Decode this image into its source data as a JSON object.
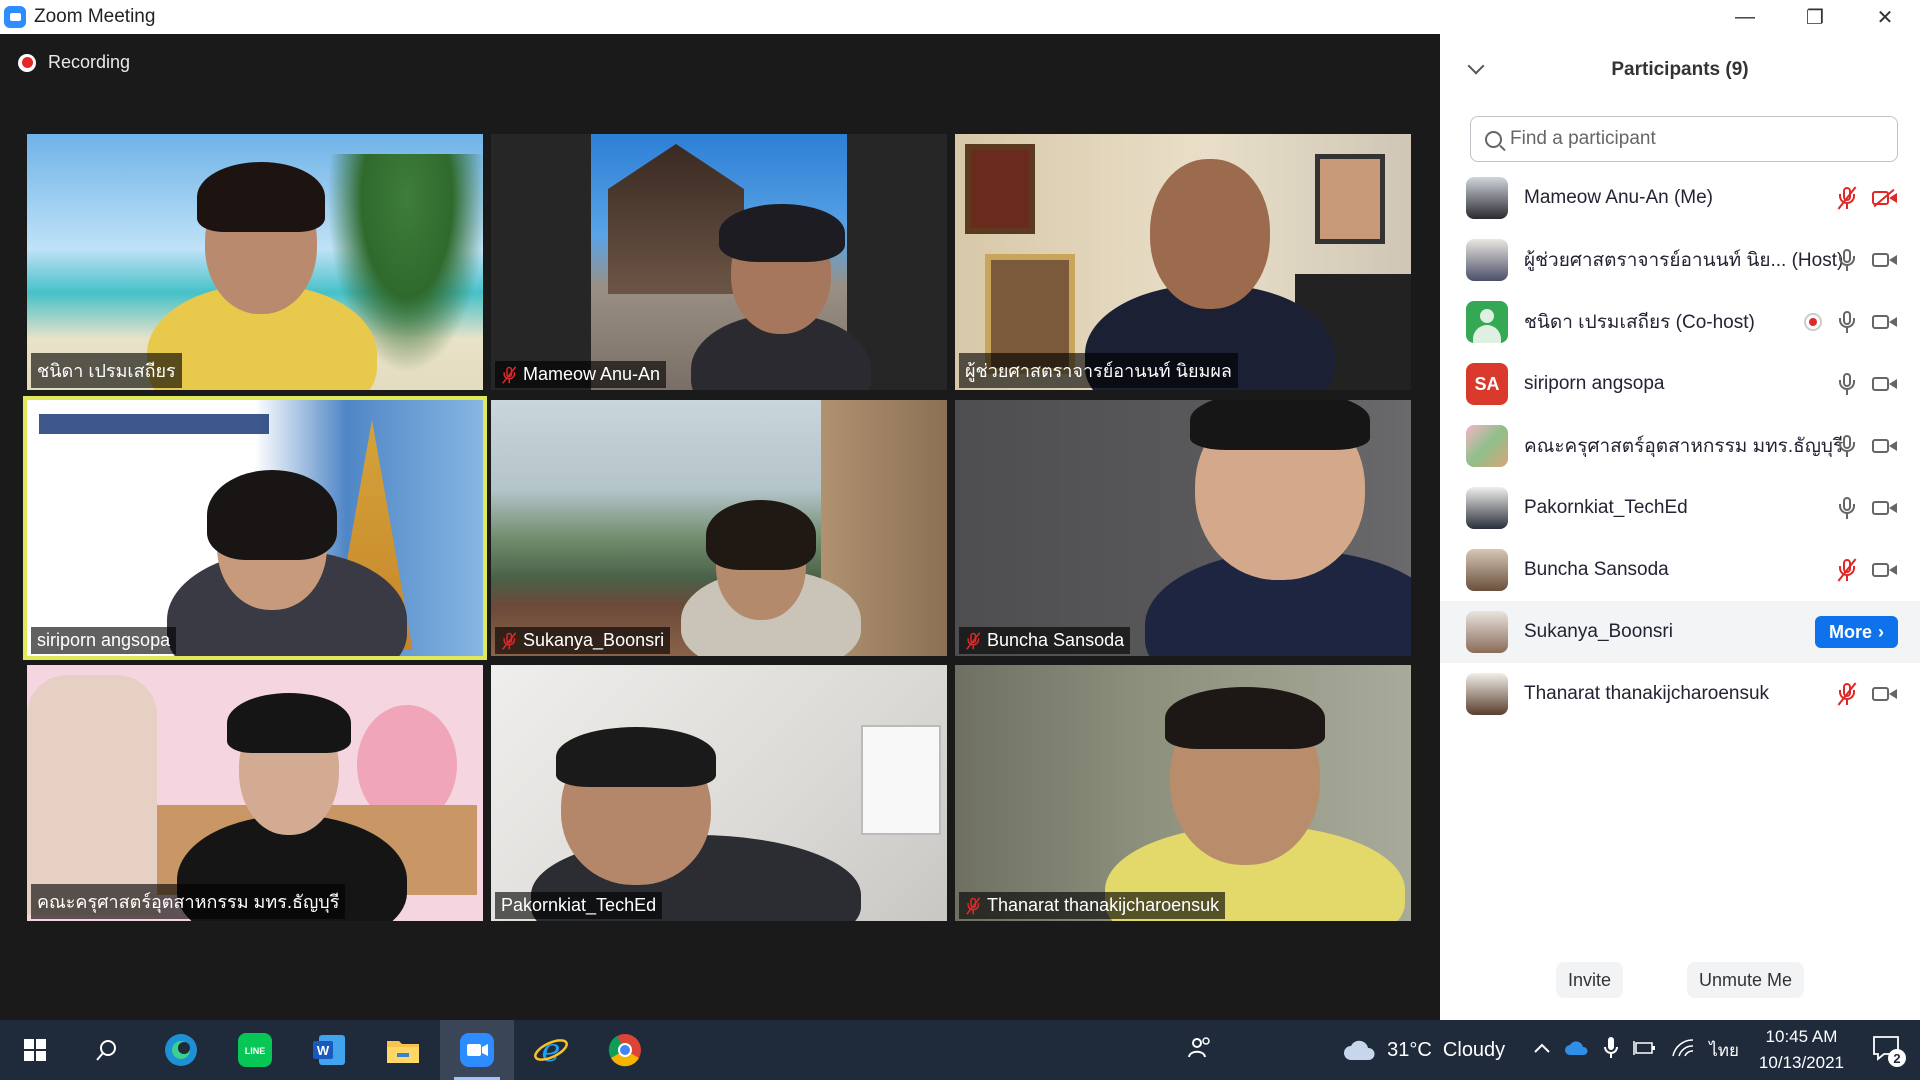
{
  "window": {
    "title": "Zoom Meeting"
  },
  "recording": {
    "label": "Recording"
  },
  "tiles": [
    {
      "name": "ชนิดา เปรมเสถียร",
      "muted": false
    },
    {
      "name": "Mameow Anu-An",
      "muted": true
    },
    {
      "name": "ผู้ช่วยศาสตราจารย์อานนท์ นิยมผล",
      "muted": false
    },
    {
      "name": "siriporn angsopa",
      "muted": false,
      "active": true
    },
    {
      "name": "Sukanya_Boonsri",
      "muted": true
    },
    {
      "name": "Buncha Sansoda",
      "muted": true
    },
    {
      "name": "คณะครุศาสตร์อุตสาหกรรม มทร.ธัญบุรี",
      "muted": false
    },
    {
      "name": "Pakornkiat_TechEd",
      "muted": false
    },
    {
      "name": "Thanarat thanakijcharoensuk",
      "muted": true
    }
  ],
  "panel": {
    "title": "Participants (9)",
    "search_placeholder": "Find a participant",
    "participants": [
      {
        "name": "Mameow Anu-An (Me)",
        "mic": "off",
        "video": "off"
      },
      {
        "name": "ผู้ช่วยศาสตราจารย์อานนท์ นิย...  (Host)",
        "mic": "on",
        "video": "on"
      },
      {
        "name": "ชนิดา เปรมเสถียร (Co-host)",
        "mic": "on",
        "video": "on",
        "recording": true
      },
      {
        "name": "siriporn angsopa",
        "avatar_text": "SA",
        "mic": "on",
        "video": "on"
      },
      {
        "name": "คณะครุศาสตร์อุตสาหกรรม มทร.ธัญบุรี",
        "mic": "on",
        "video": "on"
      },
      {
        "name": "Pakornkiat_TechEd",
        "mic": "on",
        "video": "on"
      },
      {
        "name": "Buncha Sansoda",
        "mic": "off",
        "video": "on"
      },
      {
        "name": "Sukanya_Boonsri",
        "more_label": "More"
      },
      {
        "name": "Thanarat thanakijcharoensuk",
        "mic": "off",
        "video": "on"
      }
    ],
    "invite_label": "Invite",
    "unmute_label": "Unmute Me"
  },
  "taskbar": {
    "weather": "31°C  Cloudy",
    "lang": "ไทย",
    "time": "10:45 AM",
    "date": "10/13/2021",
    "notifications": "2"
  },
  "colors": {
    "zoom_blue": "#2D8CFF",
    "muted_red": "#E02828",
    "active_speaker": "#DFE95A",
    "more_button": "#0E72ED"
  }
}
